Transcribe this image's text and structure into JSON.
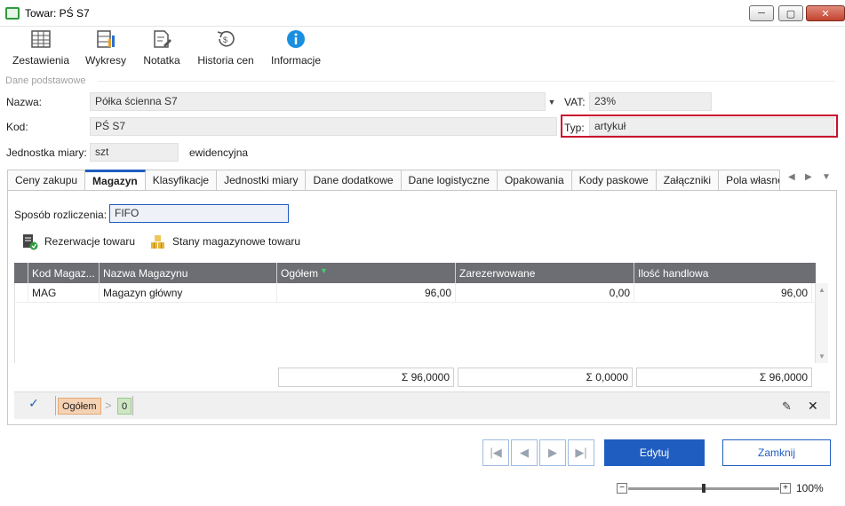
{
  "window": {
    "title": "Towar: PŚ S7",
    "minimize": "─",
    "maximize": "▢",
    "close": "✕"
  },
  "ribbon": [
    {
      "label": "Zestawienia",
      "icon": "table-icon"
    },
    {
      "label": "Wykresy",
      "icon": "chart-icon"
    },
    {
      "label": "Notatka",
      "icon": "note-icon"
    },
    {
      "label": "Historia cen",
      "icon": "history-icon"
    },
    {
      "label": "Informacje",
      "icon": "info-icon"
    }
  ],
  "section": {
    "label": "Dane podstawowe"
  },
  "form": {
    "nazwa_label": "Nazwa:",
    "nazwa_value": "Półka ścienna S7",
    "vat_label": "VAT:",
    "vat_value": "23%",
    "kod_label": "Kod:",
    "kod_value": "PŚ S7",
    "typ_label": "Typ:",
    "typ_value": "artykuł",
    "jm_label": "Jednostka miary:",
    "jm_value": "szt",
    "jm_suffix": "ewidencyjna"
  },
  "tabs": [
    "Ceny zakupu",
    "Magazyn",
    "Klasyfikacje",
    "Jednostki miary",
    "Dane dodatkowe",
    "Dane logistyczne",
    "Opakowania",
    "Kody paskowe",
    "Załączniki",
    "Pola własne"
  ],
  "active_tab": "Magazyn",
  "magazyn": {
    "sposob_label": "Sposób rozliczenia:",
    "sposob_value": "FIFO",
    "rezerwacje_label": "Rezerwacje towaru",
    "stany_label": "Stany magazynowe towaru"
  },
  "grid": {
    "columns": [
      "Kod Magaz...",
      "Nazwa Magazynu",
      "Ogółem",
      "Zarezerwowane",
      "Ilość handlowa"
    ],
    "rows": [
      [
        "MAG",
        "Magazyn główny",
        "96,00",
        "0,00",
        "96,00"
      ]
    ],
    "sums": [
      "Σ 96,0000",
      "Σ 0,0000",
      "Σ 96,0000"
    ]
  },
  "filter": {
    "chip_label": "Ogółem",
    "chip_value": "0"
  },
  "footer": {
    "edit_label": "Edytuj",
    "close_label": "Zamknij",
    "zoom": "100%"
  },
  "colors": {
    "accent": "#1f5dc0",
    "highlight_border": "#c8102e",
    "grid_header": "#6d6e74"
  }
}
